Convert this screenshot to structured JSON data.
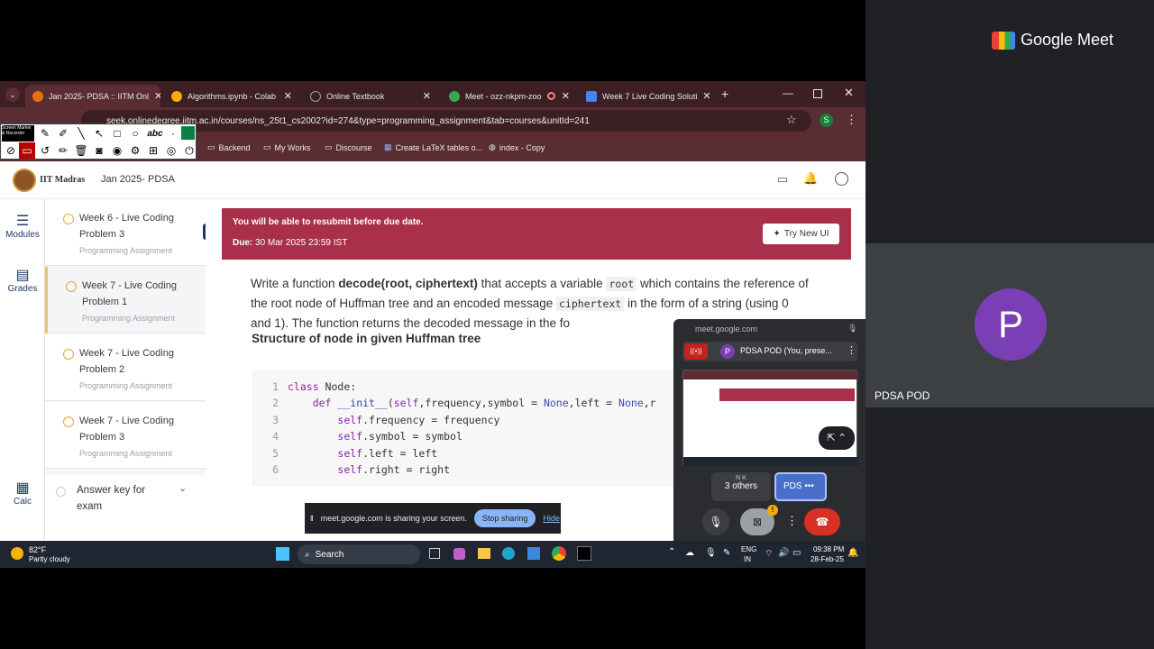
{
  "meet": {
    "brand": "Google Meet",
    "participant_initial": "P",
    "participant_name": "PDSA POD"
  },
  "tabs": [
    {
      "label": "Jan 2025- PDSA :: IITM Onl",
      "color": "#e8710a"
    },
    {
      "label": "Algorithms.ipynb - Colab",
      "color": "#f9ab00"
    },
    {
      "label": "Online Textbook",
      "color": "#9aa0a6"
    },
    {
      "label": "Meet - ozz-nkpm-zoo",
      "color": "#1a73e8"
    },
    {
      "label": "Week 7 Live Coding Soluti",
      "color": "#4285f4"
    }
  ],
  "url": "seek.onlinedegree.iitm.ac.in/courses/ns_25t1_cs2002?id=274&type=programming_assignment&tab=courses&unitId=241",
  "profile_initial": "S",
  "bookmarks": [
    "Backend",
    "My Works",
    "Discourse",
    "Create LaTeX tables o...",
    "index - Copy"
  ],
  "annotator_label": "Screen Marker & Recorder",
  "site": {
    "org": "IIT Madras",
    "course": "Jan 2025- PDSA"
  },
  "rail": {
    "modules": "Modules",
    "grades": "Grades",
    "calc": "Calc"
  },
  "modules": [
    {
      "title": "Week 6 - Live Coding Problem 3",
      "subtitle": "Programming Assignment"
    },
    {
      "title": "Week 7 - Live Coding Problem 1",
      "subtitle": "Programming Assignment"
    },
    {
      "title": "Week 7 - Live Coding Problem 2",
      "subtitle": "Programming Assignment"
    },
    {
      "title": "Week 7 - Live Coding Problem 3",
      "subtitle": "Programming Assignment"
    }
  ],
  "answer_key": "Answer key for exam",
  "banner": {
    "resubmit": "You will be able to resubmit before due date.",
    "due_label": "Due:",
    "due_value": "30 Mar 2025 23:59 IST",
    "try_ui": "Try New UI"
  },
  "problem": {
    "p1": "Write a function",
    "fn": "decode(root, ciphertext)",
    "p2": "that accepts a variable",
    "c1": "root",
    "p3": "which contains the reference of the root node of Huffman tree and an encoded message",
    "c2": "ciphertext",
    "p4": "in the form of a string (using 0 and 1). The function returns the decoded message in the fo",
    "heading": "Structure of node in given Huffman tree"
  },
  "code_lines": [
    "1",
    "2",
    "3",
    "4",
    "5",
    "6"
  ],
  "sharebar": {
    "text": "meet.google.com is sharing your screen.",
    "stop": "Stop sharing",
    "hide": "Hide"
  },
  "taskbar": {
    "temp": "82°F",
    "weather": "Partly cloudy",
    "search": "Search",
    "lang1": "ENG",
    "lang2": "IN",
    "time": "09:38 PM",
    "date": "28-Feb-25"
  },
  "popup": {
    "domain": "meet.google.com",
    "presenter": "PDSA POD (You, prese...",
    "others": "3 others",
    "self": "PDS"
  }
}
